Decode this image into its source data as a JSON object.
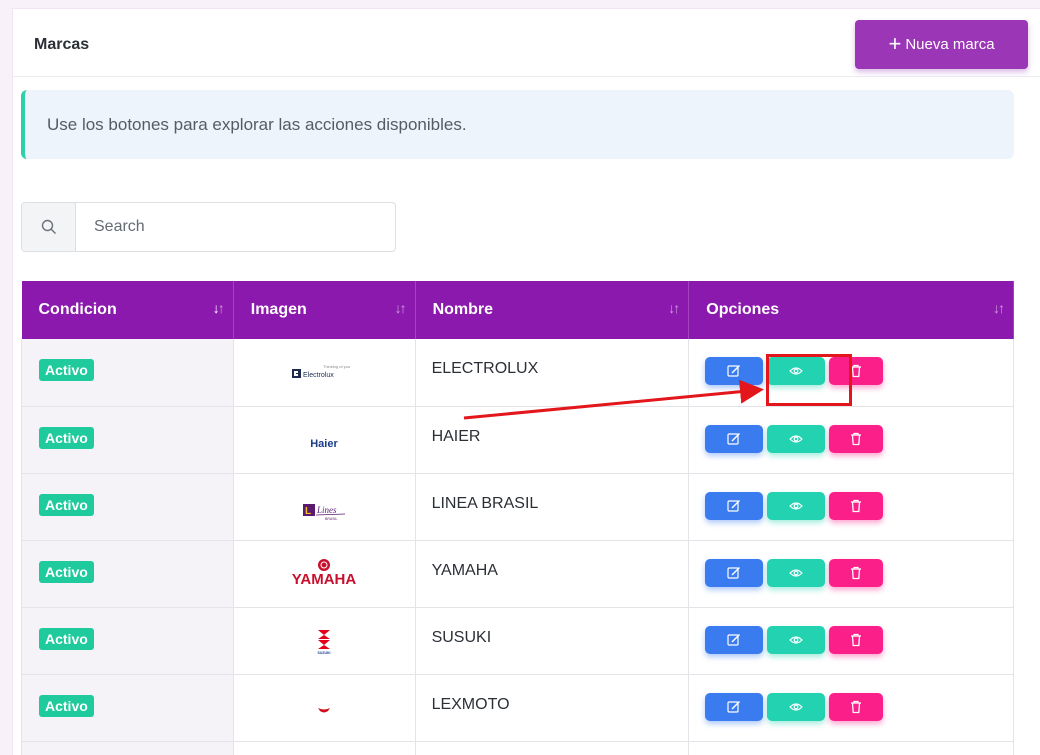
{
  "header": {
    "title": "Marcas",
    "new_button_label": "Nueva marca"
  },
  "alert": {
    "text": "Use los botones para explorar las acciones disponibles."
  },
  "search": {
    "placeholder": "Search",
    "value": ""
  },
  "table": {
    "columns": [
      "Condicion",
      "Imagen",
      "Nombre",
      "Opciones"
    ],
    "rows": [
      {
        "status": "Activo",
        "logo": "electrolux-logo",
        "name": "ELECTROLUX"
      },
      {
        "status": "Activo",
        "logo": "haier-logo",
        "name": "HAIER"
      },
      {
        "status": "Activo",
        "logo": "linea-brasil-logo",
        "name": "LINEA BRASIL"
      },
      {
        "status": "Activo",
        "logo": "yamaha-logo",
        "name": "YAMAHA"
      },
      {
        "status": "Activo",
        "logo": "suzuki-logo",
        "name": "SUSUKI"
      },
      {
        "status": "Activo",
        "logo": "lexmoto-logo",
        "name": "LEXMOTO"
      }
    ],
    "logo_text": {
      "electrolux": "Electrolux",
      "electrolux_tagline": "Thinking of you",
      "haier": "Haier",
      "linea": "Lines",
      "linea_sub": "BRASIL",
      "yamaha": "YAMAHA",
      "suzuki": "SUZUKI"
    }
  },
  "colors": {
    "accent": "#9b36b6",
    "table_header": "#8c19ad",
    "active_badge": "#1fcb9c",
    "edit": "#3a7bef",
    "view": "#22d2b0",
    "delete": "#fb1f8a",
    "annotation": "#e3161b"
  }
}
